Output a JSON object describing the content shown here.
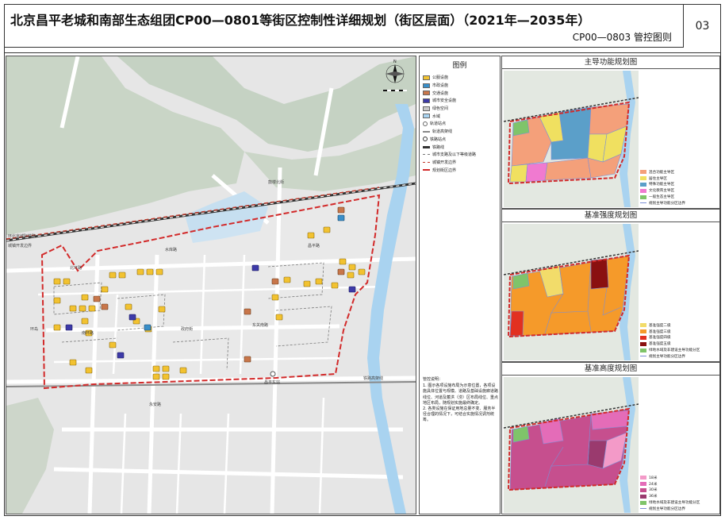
{
  "header": {
    "title": "北京昌平老城和南部生态组团CP00—0801等街区控制性详细规划（街区层面）（2021年—2035年）",
    "subtitle": "CP00—0803  管控图则",
    "page_number": "03"
  },
  "legend": {
    "title": "图例",
    "items": [
      {
        "label": "公服设施",
        "color": "#f2c230"
      },
      {
        "label": "市政设施",
        "color": "#3a8fc9"
      },
      {
        "label": "交通设施",
        "color": "#c8764a"
      },
      {
        "label": "城市安全设施",
        "color": "#3d3aa8"
      },
      {
        "label": "绿色空间",
        "color": "#c9c9c9"
      },
      {
        "label": "水域",
        "color": "#a9d3f0"
      },
      {
        "label": "轨道站点",
        "color": "#ffffff"
      },
      {
        "label": "轨道高架线",
        "color": "#ffffff"
      },
      {
        "label": "铁路站点",
        "color": "#ffffff"
      },
      {
        "label": "铁路线",
        "color": "#ffffff"
      },
      {
        "label": "城市支路及以下等级道路",
        "color": "#ffffff"
      },
      {
        "label": "城镇开发边界",
        "color": "#ffffff"
      },
      {
        "label": "规划街区边界",
        "color": "#ffffff"
      }
    ],
    "notes_heading": "管控说明：",
    "notes": [
      "1. 图示各项设施布局为示意位置，各项设施具体位置与规模、道路及基础设施廊道路线位、河道及蓄洪（涝）区布局线位、重点地区布局，随规划实施最终确定。",
      "2. 各类设施在保证用地总量不变、服务半径合理的情况下，可结合实施情况调剂统筹。"
    ]
  },
  "map": {
    "road_labels": [
      "北环路",
      "政府街",
      "昌平路",
      "水库路",
      "鼓楼北街",
      "东关南路",
      "环岛",
      "南环路",
      "永安路"
    ],
    "edge_labels": [
      "环北京城际铁路",
      "城镇开发边界",
      "铁路高架线"
    ],
    "station_label": "昌平东站",
    "icon_counts": {
      "public": 40,
      "municipal": 2,
      "transport": 7,
      "safety": 4
    }
  },
  "panels": [
    {
      "title": "主导功能规划图",
      "legend": [
        {
          "label": "混合功能主导区",
          "color": "#f4a07a"
        },
        {
          "label": "居住主导区",
          "color": "#f0e060"
        },
        {
          "label": "特殊功能主导区",
          "color": "#5b9fc9"
        },
        {
          "label": "文化教育主导区",
          "color": "#f07ad0"
        },
        {
          "label": "一般生态主导区",
          "color": "#7fc46a"
        },
        {
          "label": "规划主导功能分区边界",
          "color": "#7b8fd6"
        }
      ]
    },
    {
      "title": "基准强度规划图",
      "legend": [
        {
          "label": "基准强度二级",
          "color": "#f2dc6a"
        },
        {
          "label": "基准强度三级",
          "color": "#f59a2a"
        },
        {
          "label": "基准强度四级",
          "color": "#e23020"
        },
        {
          "label": "基准强度五级",
          "color": "#8a1010"
        },
        {
          "label": "绿地水域及非建设主导功能分区",
          "color": "#7fc46a"
        },
        {
          "label": "规划主导功能分区边界",
          "color": "#7b8fd6"
        }
      ]
    },
    {
      "title": "基准高度规划图",
      "legend": [
        {
          "label": "18米",
          "color": "#f39ac8"
        },
        {
          "label": "24米",
          "color": "#e46cb8"
        },
        {
          "label": "30米",
          "color": "#c64f8e"
        },
        {
          "label": "36米",
          "color": "#9a3a6e"
        },
        {
          "label": "绿地水域及非建设主导功能分区",
          "color": "#7fc46a"
        },
        {
          "label": "规划主导功能分区边界",
          "color": "#7b8fd6"
        }
      ]
    }
  ]
}
